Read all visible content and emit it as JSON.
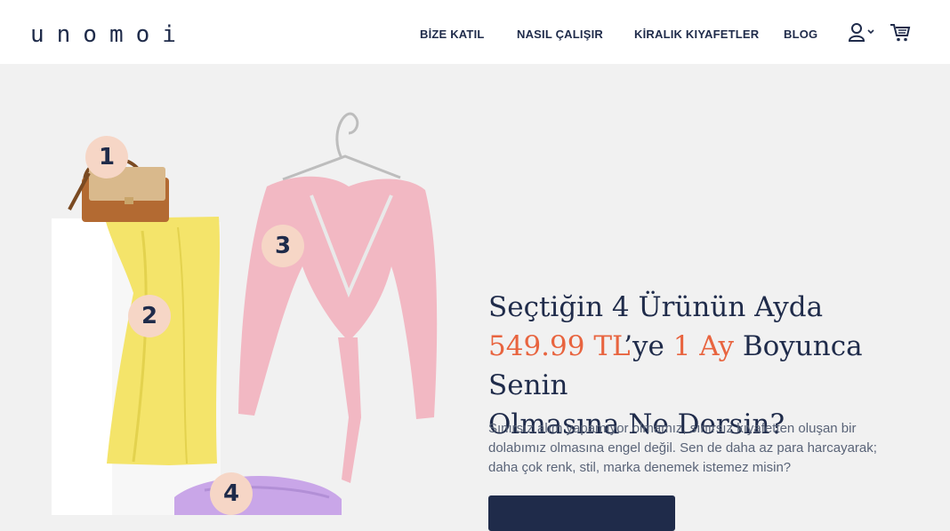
{
  "header": {
    "logo": "unomoi",
    "nav": [
      {
        "label": "BİZE KATIL"
      },
      {
        "label": "NASIL ÇALIŞIR"
      },
      {
        "label": "KİRALIK KIYAFETLER"
      },
      {
        "label": "BLOG"
      }
    ],
    "icons": [
      "user-icon",
      "chevron-down-icon",
      "cart-icon"
    ]
  },
  "hero": {
    "badges": [
      "1",
      "2",
      "3",
      "4"
    ],
    "headline": {
      "line1": "Seçtiğin 4 Ürünün Ayda",
      "price": "549.99 TL",
      "mid": "’ye ",
      "duration": "1 Ay",
      "line2_end": " Boyunca Senin",
      "line3": "Olmasına Ne Dersin?"
    },
    "description": "Sınırsız alım yapamıyor olmamız, sınırsız kıyafetten oluşan bir dolabımız olmasına engel değil. Sen de daha az para harcayarak; daha çok renk, stil, marka denemek istemez misin?",
    "colors": {
      "navy": "#1f2b4a",
      "accent": "#e8643f",
      "badge": "#f6d6c6"
    }
  }
}
